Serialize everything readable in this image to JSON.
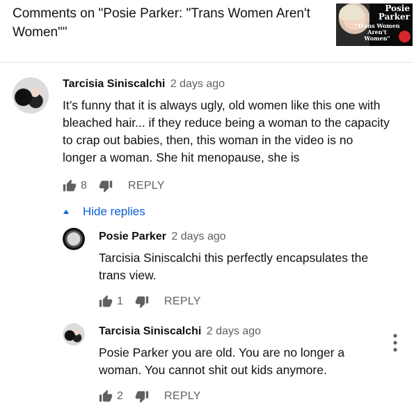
{
  "header": {
    "title": "Comments on \"Posie Parker: \"Trans Women Aren't Women\"\"",
    "thumbnail": {
      "name_line1": "Posie",
      "name_line2": "Parker",
      "subtitle": "\"Trans Women Aren't Women\""
    }
  },
  "comments": [
    {
      "author": "Tarcisia Siniscalchi",
      "time": "2 days ago",
      "text": "It’s funny that it is always ugly, old women like this one with bleached hair... if they reduce being a woman to the capacity to crap out babies, then, this woman in the video is no longer a woman. She hit menopause, she is",
      "likes": "8",
      "reply_label": "REPLY"
    }
  ],
  "hide_replies_label": "Hide replies",
  "replies": [
    {
      "author": "Posie Parker",
      "time": "2 days ago",
      "text": "Tarcisia Siniscalchi this perfectly encapsulates the trans view.",
      "likes": "1",
      "reply_label": "REPLY"
    },
    {
      "author": "Tarcisia Siniscalchi",
      "time": "2 days ago",
      "text": "Posie Parker you are old. You are no longer a woman. You cannot shit out kids anymore.",
      "likes": "2",
      "reply_label": "REPLY"
    }
  ],
  "colors": {
    "link_blue": "#065fd4",
    "secondary_text": "#606060",
    "icon_gray": "#606060"
  },
  "icons": [
    "like-icon",
    "dislike-icon",
    "caret-up-icon",
    "more-vert-icon"
  ]
}
